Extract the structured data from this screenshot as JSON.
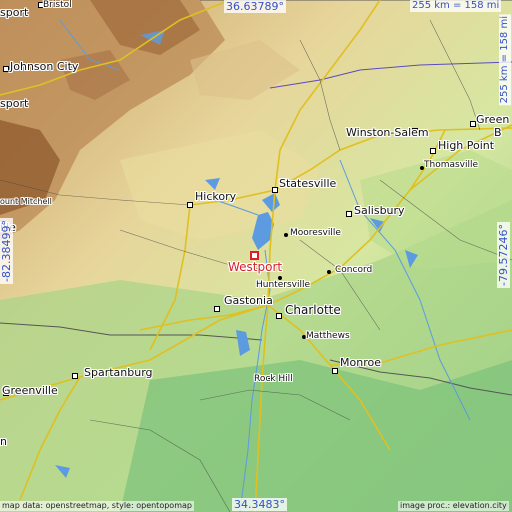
{
  "map": {
    "highlight": {
      "name": "Westport",
      "color": "#d8202e"
    },
    "coordinates": {
      "top": "36.63789°",
      "bottom": "34.3483°",
      "left": "-82.38499°",
      "right": "-79.57246°"
    },
    "scale": {
      "horizontal": "255 km = 158 mi",
      "vertical": "255 km = 158 mi"
    },
    "attribution_left": "map data: openstreetmap, style: opentopomap",
    "attribution_right": "image proc.: elevation.city",
    "places": [
      {
        "name": "Bristol",
        "size": "sm"
      },
      {
        "name": "sport",
        "size": "md"
      },
      {
        "name": "Johnson City",
        "size": "md"
      },
      {
        "name": "sport",
        "size": "md"
      },
      {
        "name": "ount Mitchell",
        "size": "xs"
      },
      {
        "name": "ille",
        "size": "md"
      },
      {
        "name": "Hickory",
        "size": "md"
      },
      {
        "name": "Statesville",
        "size": "md"
      },
      {
        "name": "Winston-Salem",
        "size": "md"
      },
      {
        "name": "Green",
        "size": "md"
      },
      {
        "name": "B",
        "size": "md"
      },
      {
        "name": "High Point",
        "size": "md"
      },
      {
        "name": "Thomasville",
        "size": "sm"
      },
      {
        "name": "Mooresville",
        "size": "sm"
      },
      {
        "name": "Salisbury",
        "size": "md"
      },
      {
        "name": "Concord",
        "size": "sm"
      },
      {
        "name": "Huntersville",
        "size": "sm"
      },
      {
        "name": "Gastonia",
        "size": "md"
      },
      {
        "name": "Charlotte",
        "size": "lg"
      },
      {
        "name": "Matthews",
        "size": "sm"
      },
      {
        "name": "Monroe",
        "size": "md"
      },
      {
        "name": "Spartanburg",
        "size": "md"
      },
      {
        "name": "Greenville",
        "size": "md"
      },
      {
        "name": "Rock Hill",
        "size": "sm"
      },
      {
        "name": "n",
        "size": "md"
      }
    ]
  }
}
